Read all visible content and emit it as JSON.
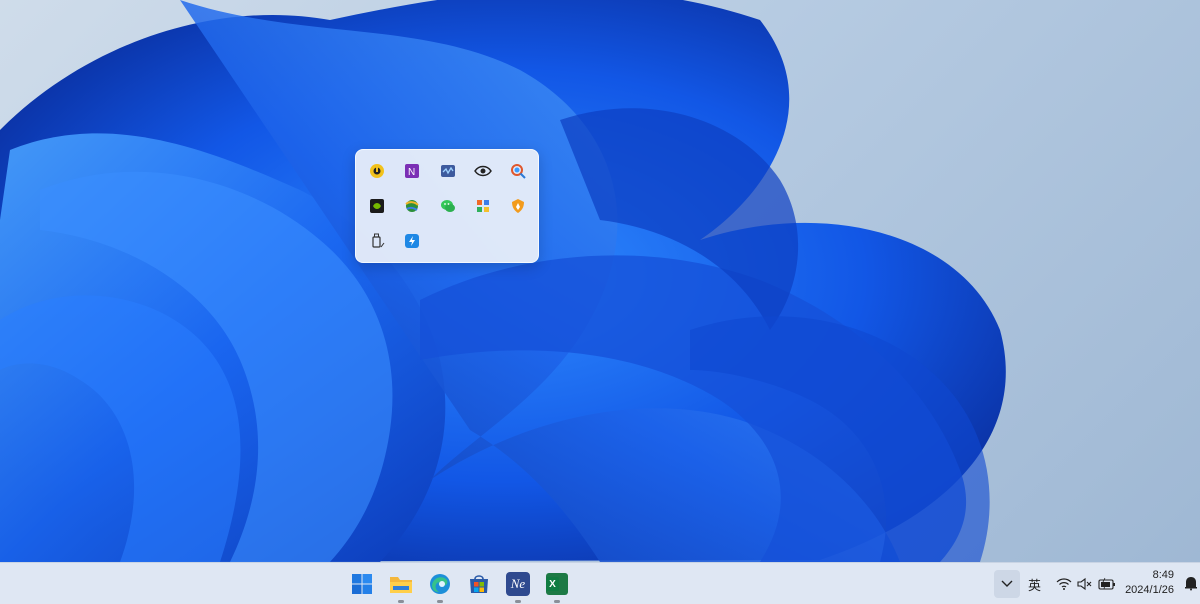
{
  "desktop": {
    "wallpaper": "windows-11-bloom-blue"
  },
  "tray_flyout": {
    "icons": [
      "screen-recorder-icon",
      "onenote-icon",
      "audio-monitor-icon",
      "eye-icon",
      "magnifier-search-icon",
      "nvidia-icon",
      "globe-sync-icon",
      "wechat-icon",
      "grid-app-icon",
      "security-shield-icon",
      "usb-drive-icon",
      "quick-share-icon"
    ]
  },
  "taskbar": {
    "apps": [
      {
        "name": "start-button",
        "icon": "windows-start-icon"
      },
      {
        "name": "file-explorer-button",
        "icon": "folder-icon",
        "running": true
      },
      {
        "name": "edge-button",
        "icon": "edge-icon",
        "running": true
      },
      {
        "name": "microsoft-store-button",
        "icon": "store-icon"
      },
      {
        "name": "ne-app-button",
        "label": "Ne",
        "icon": "ne-app-icon",
        "running": true
      },
      {
        "name": "excel-button",
        "label": "X",
        "icon": "excel-icon",
        "running": true
      }
    ],
    "tray": {
      "input_language": "英",
      "time": "8:49",
      "date": "2024/1/26"
    }
  },
  "colors": {
    "taskbar_bg": "#dfe7f3",
    "flyout_bg": "#eef2fa",
    "accent_blue": "#1f6fe5"
  }
}
